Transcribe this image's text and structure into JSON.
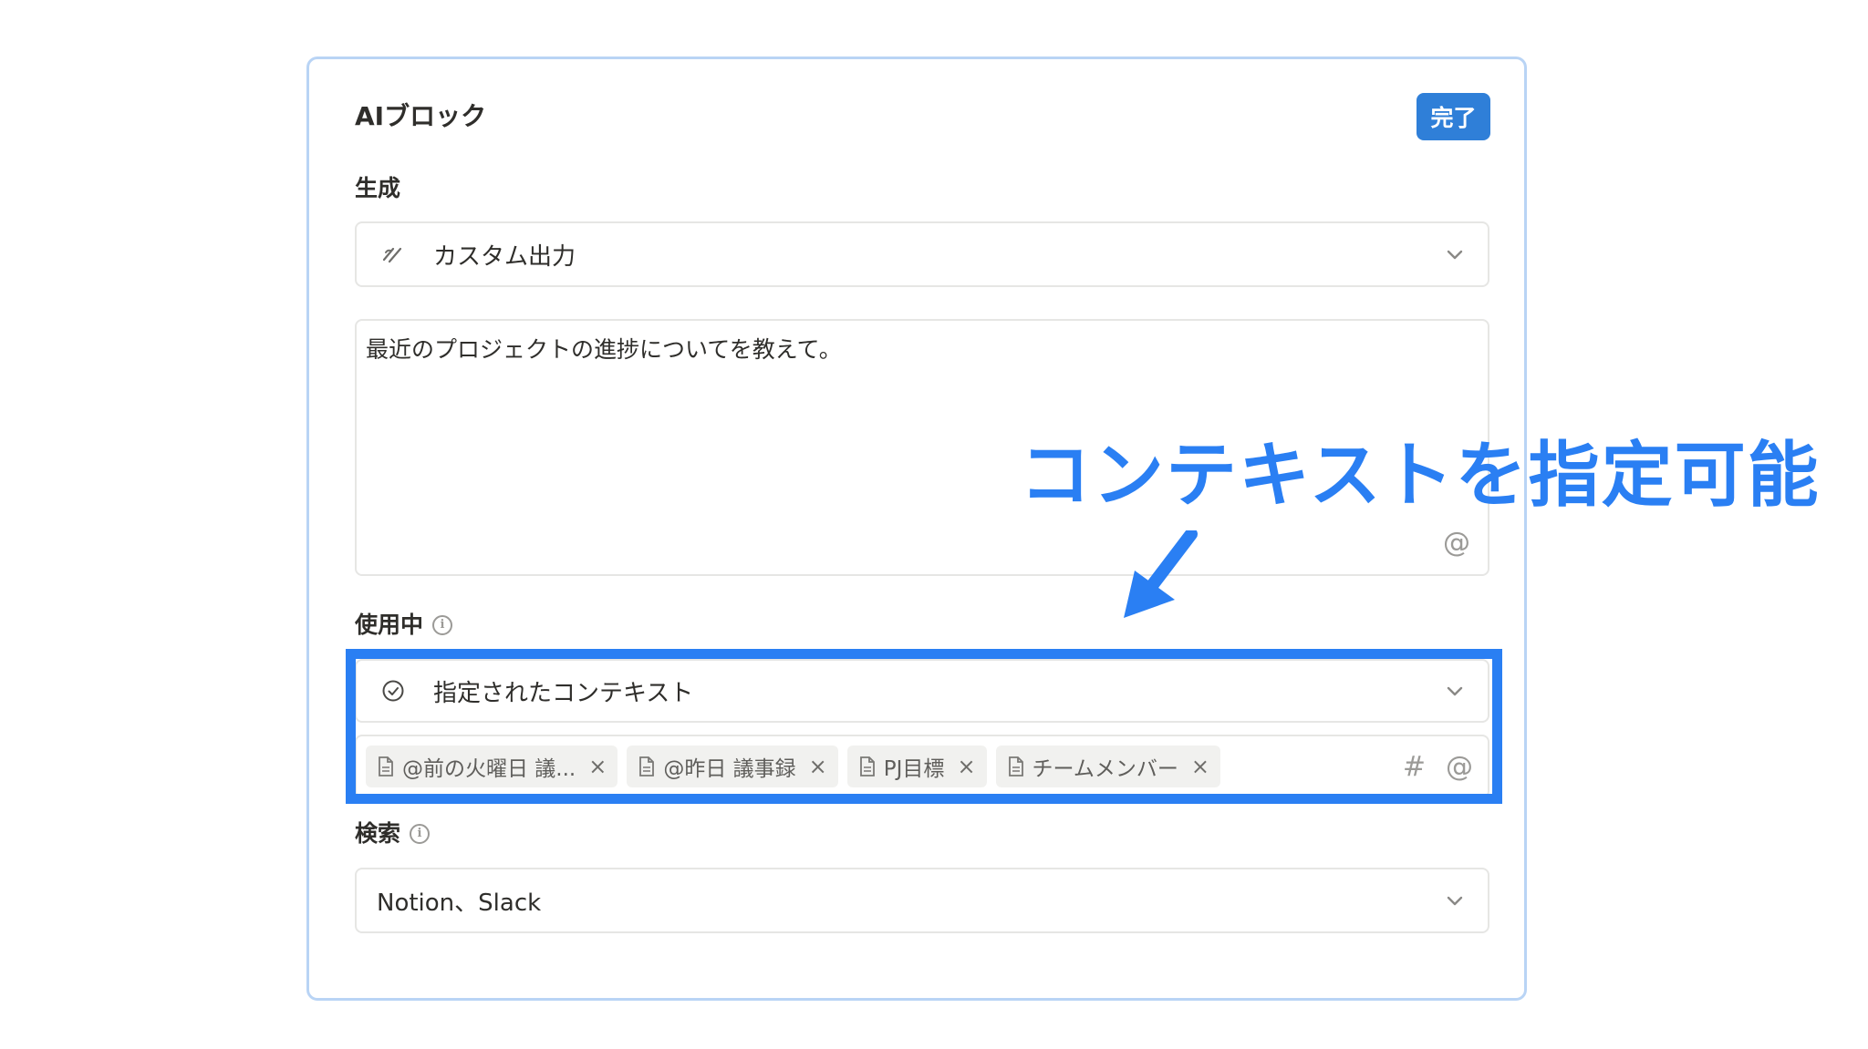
{
  "panel": {
    "title": "AIブロック",
    "done_label": "完了"
  },
  "generate": {
    "label": "生成",
    "value": "カスタム出力"
  },
  "prompt": {
    "text": "最近のプロジェクトの進捗についてを教えて。",
    "mention_symbol": "@"
  },
  "in_use": {
    "label": "使用中",
    "value": "指定されたコンテキスト",
    "chips": [
      {
        "label": "@前の火曜日 議..."
      },
      {
        "label": "@昨日 議事録"
      },
      {
        "label": "PJ目標"
      },
      {
        "label": "チームメンバー"
      }
    ],
    "hash_symbol": "#",
    "mention_symbol": "@",
    "remove_symbol": "×"
  },
  "search": {
    "label": "検索",
    "value": "Notion、Slack"
  },
  "annotation": {
    "text": "コンテキストを指定可能",
    "color": "#2a7ff3"
  },
  "colors": {
    "accent": "#2f7fd8",
    "highlight": "#2a7ff3",
    "border": "#e6e6e4",
    "panel_border": "#b9d4f5"
  }
}
